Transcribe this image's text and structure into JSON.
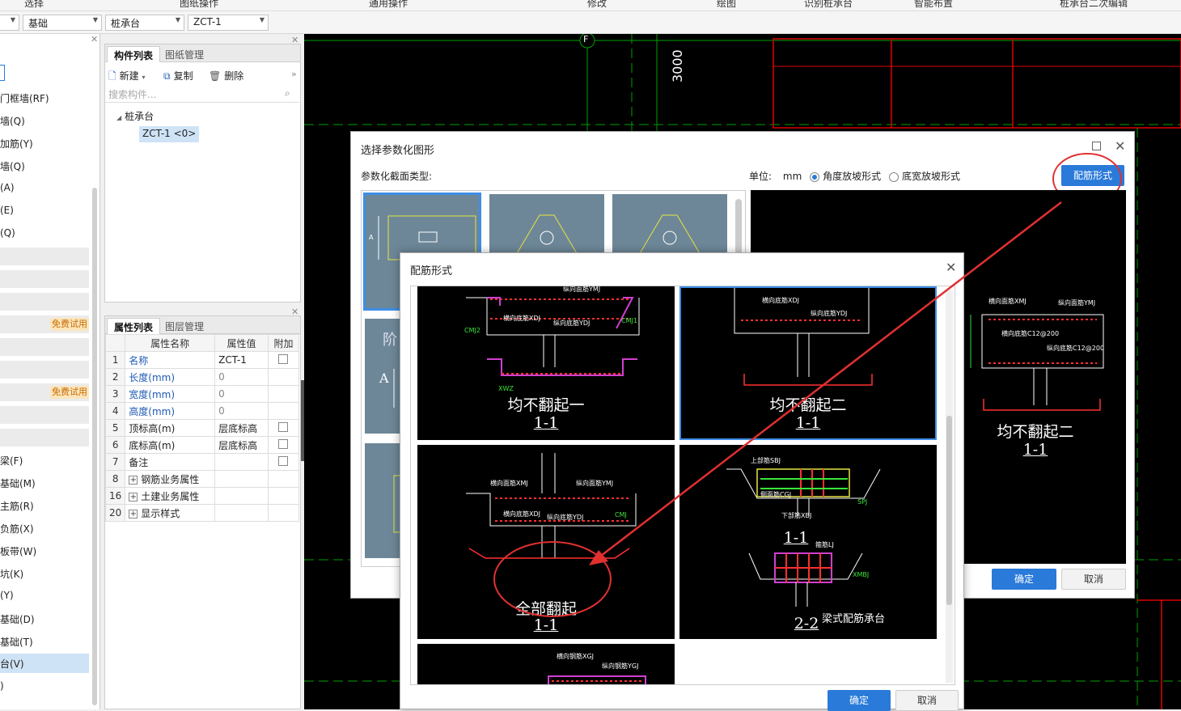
{
  "top_menu": [
    "选择",
    "图纸操作",
    "通用操作",
    "修改",
    "绘图",
    "识别桩承台",
    "智能布置",
    "桩承台二次编辑"
  ],
  "toolbar": {
    "combo1": "基础",
    "combo2": "桩承台",
    "combo3": "ZCT-1"
  },
  "left_nav": {
    "items": [
      "门框墙(RF)",
      "墙(Q)",
      "加筋(Y)",
      "墙(Q)",
      "(A)",
      "(E)",
      "(Q)",
      "梁(F)",
      "基础(M)",
      "主筋(R)",
      "负筋(X)",
      "板带(W)",
      "坑(K)",
      "(Y)",
      "基础(D)",
      "基础(T)",
      "台(V)",
      ")"
    ],
    "trial_label": "免费试用"
  },
  "component_panel": {
    "tabs": [
      "构件列表",
      "图纸管理"
    ],
    "new_label": "新建",
    "copy_label": "复制",
    "delete_label": "删除",
    "search_placeholder": "搜索构件...",
    "tree_root": "桩承台",
    "tree_child": "ZCT-1 <0>"
  },
  "property_panel": {
    "tabs": [
      "属性列表",
      "图层管理"
    ],
    "headers": [
      "属性名称",
      "属性值",
      "附加"
    ],
    "rows": [
      {
        "num": "1",
        "name": "名称",
        "value": "ZCT-1"
      },
      {
        "num": "2",
        "name": "长度(mm)",
        "value": "0"
      },
      {
        "num": "3",
        "name": "宽度(mm)",
        "value": "0"
      },
      {
        "num": "4",
        "name": "高度(mm)",
        "value": "0"
      },
      {
        "num": "5",
        "name": "顶标高(m)",
        "value": "层底标高"
      },
      {
        "num": "6",
        "name": "底标高(m)",
        "value": "层底标高"
      },
      {
        "num": "7",
        "name": "备注",
        "value": ""
      },
      {
        "num": "8",
        "name": "钢筋业务属性",
        "value": ""
      },
      {
        "num": "16",
        "name": "土建业务属性",
        "value": ""
      },
      {
        "num": "20",
        "name": "显示样式",
        "value": ""
      }
    ]
  },
  "canvas": {
    "axis_label": "F",
    "dimension": "3000"
  },
  "dialog_param": {
    "title": "选择参数化图形",
    "section_label": "参数化截面类型:",
    "unit_label": "单位:",
    "unit_value": "mm",
    "radio1": "角度放坡形式",
    "radio2": "底宽放坡形式",
    "rebar_button": "配筋形式",
    "thumb_labels": [
      "阶",
      "A"
    ],
    "preview_title": "均不翻起二",
    "preview_section": "1-1",
    "preview_labels": [
      "横向面筋XMJ",
      "纵向面筋YMJ",
      "横向底筋C12@200",
      "纵向底筋C12@200"
    ],
    "ok": "确定",
    "cancel": "取消"
  },
  "dialog_rebar": {
    "title": "配筋形式",
    "cards": [
      {
        "title": "均不翻起一",
        "section": "1-1",
        "labels": [
          "纵向面筋YMJ",
          "横向底筋XDJ",
          "纵向底筋YDJ",
          "CMJ1",
          "CMJ2",
          "XWZ"
        ]
      },
      {
        "title": "均不翻起二",
        "section": "1-1",
        "labels": [
          "横向底筋XDJ",
          "纵向底筋YDJ"
        ]
      },
      {
        "title": "全部翻起",
        "section": "1-1",
        "labels": [
          "横向面筋XMJ",
          "纵向面筋YMJ",
          "横向底筋XDJ",
          "纵向底筋YDJ",
          "CMJ"
        ]
      },
      {
        "title": "梁式配筋承台",
        "section": "2-2",
        "section_top": "1-1",
        "labels": [
          "上部筋SBJ",
          "侧面筋CGJ",
          "下部筋XBJ",
          "箍筋LJ",
          "SPJ",
          "XMBJ"
        ]
      },
      {
        "title": "",
        "section": "",
        "labels": [
          "横向钢筋XGJ",
          "纵向钢筋YGJ"
        ]
      }
    ],
    "ok": "确定",
    "cancel": "取消"
  },
  "colors": {
    "accent": "#2a7ad9",
    "annotation": "#e03030",
    "cad_red": "#e00000",
    "cad_green": "#00b000"
  }
}
